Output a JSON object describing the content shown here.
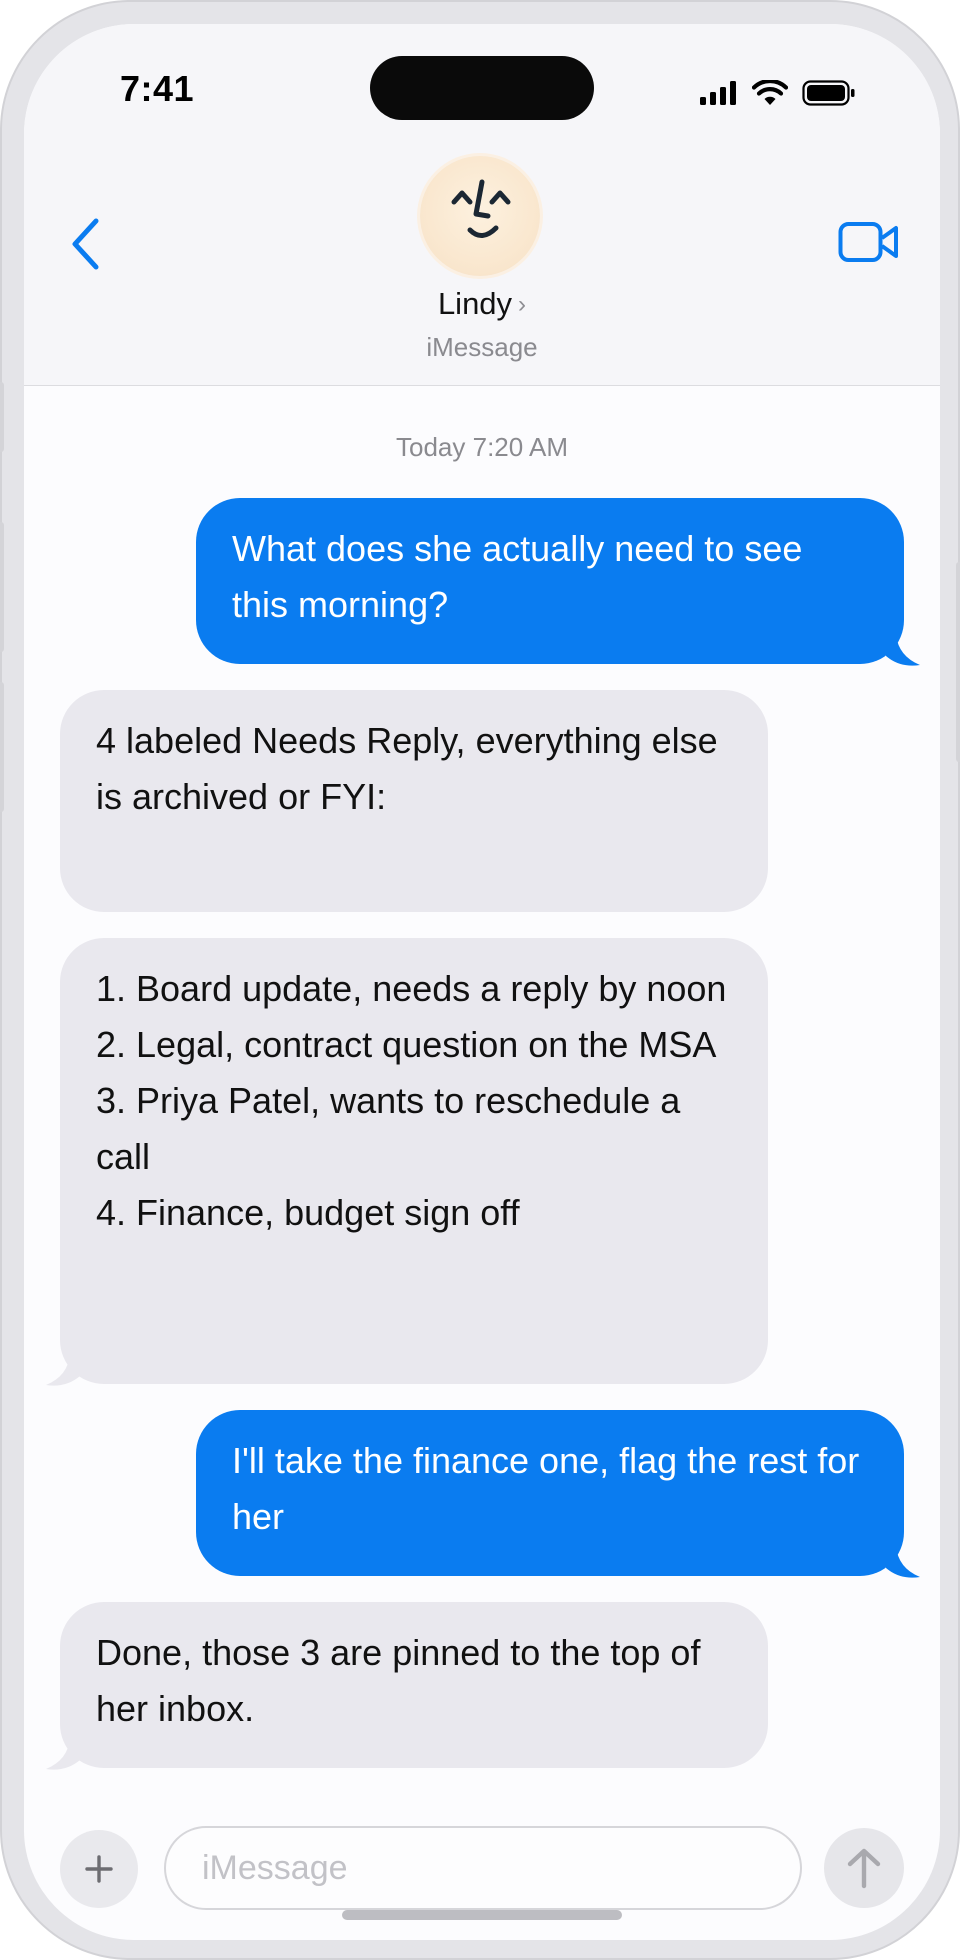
{
  "status_bar": {
    "time": "7:41",
    "icons": [
      "signal-icon",
      "wifi-icon",
      "battery-icon"
    ]
  },
  "header": {
    "back_icon": "chevron-left-icon",
    "video_icon": "video-camera-icon",
    "contact_name": "Lindy",
    "contact_chevron": "›",
    "contact_subtitle": "iMessage"
  },
  "conversation": {
    "timestamp": "Today 7:20 AM",
    "messages": [
      {
        "direction": "outgoing",
        "text": "What does she actually need to see this morning?"
      },
      {
        "direction": "incoming",
        "text": "4 labeled Needs Reply, everything else is archived or FYI:"
      },
      {
        "direction": "incoming",
        "text": "1. Board update, needs a reply by noon\n2. Legal, contract question on the MSA\n3. Priya Patel, wants to reschedule a call\n4. Finance, budget sign off"
      },
      {
        "direction": "outgoing",
        "text": "I'll take the finance one, flag the rest for her"
      },
      {
        "direction": "incoming",
        "text": "Done, those 3 are pinned to the top of her inbox."
      }
    ]
  },
  "composer": {
    "plus_label": "+",
    "placeholder": "iMessage",
    "send_icon": "arrow-up-icon"
  },
  "colors": {
    "accent": "#0a7cf0",
    "incoming_bubble": "#e9e8ee",
    "secondary_text": "#8a8a8f"
  }
}
